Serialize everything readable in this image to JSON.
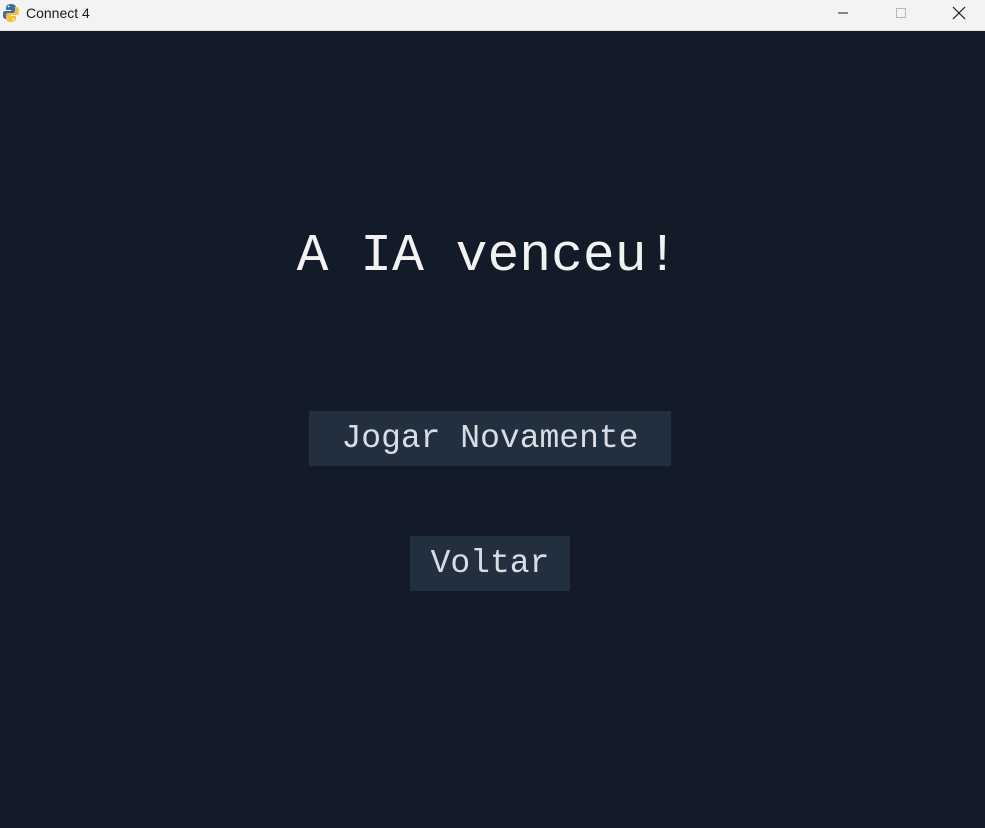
{
  "window": {
    "title": "Connect 4",
    "icon": "python-snake-icon"
  },
  "controls": {
    "minimize_icon": "minimize-icon",
    "maximize_icon": "maximize-icon",
    "close_icon": "close-icon"
  },
  "game": {
    "result_message": "A IA venceu!",
    "play_again_label": "Jogar Novamente",
    "back_label": "Voltar"
  },
  "colors": {
    "background": "#121b27",
    "button_bg": "#222f3f",
    "button_text": "#d9dde3",
    "headline_text": "#f2f2f2"
  }
}
